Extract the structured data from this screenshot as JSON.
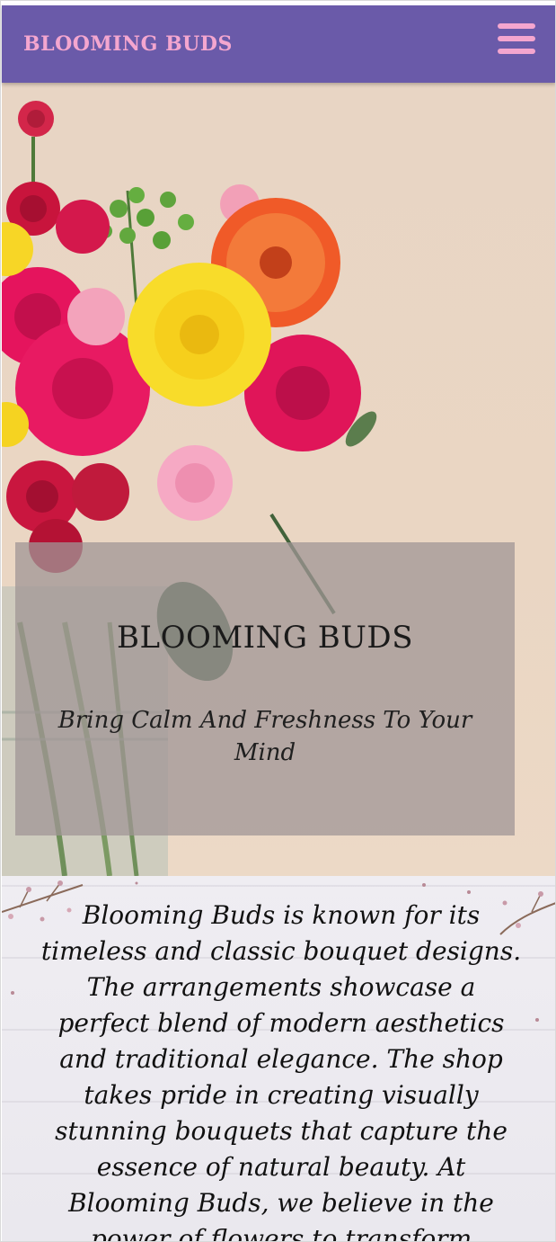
{
  "header": {
    "brand": "BLOOMING BUDS",
    "menu_icon": "hamburger-menu-icon",
    "background_color": "#6a5aa9",
    "brand_color": "#f4a6cf"
  },
  "hero": {
    "image": "flower-bouquet-image",
    "title": "BLOOMING BUDS",
    "tagline": "Bring Calm And Freshness To Your Mind"
  },
  "about": {
    "text": "Blooming Buds is known for its timeless and classic bouquet designs. The arrangements showcase a perfect blend of modern aesthetics and traditional elegance. The shop takes pride in creating visually stunning bouquets that capture the essence of natural beauty. At Blooming Buds, we believe in the power of flowers to transform ordinary moments into"
  }
}
